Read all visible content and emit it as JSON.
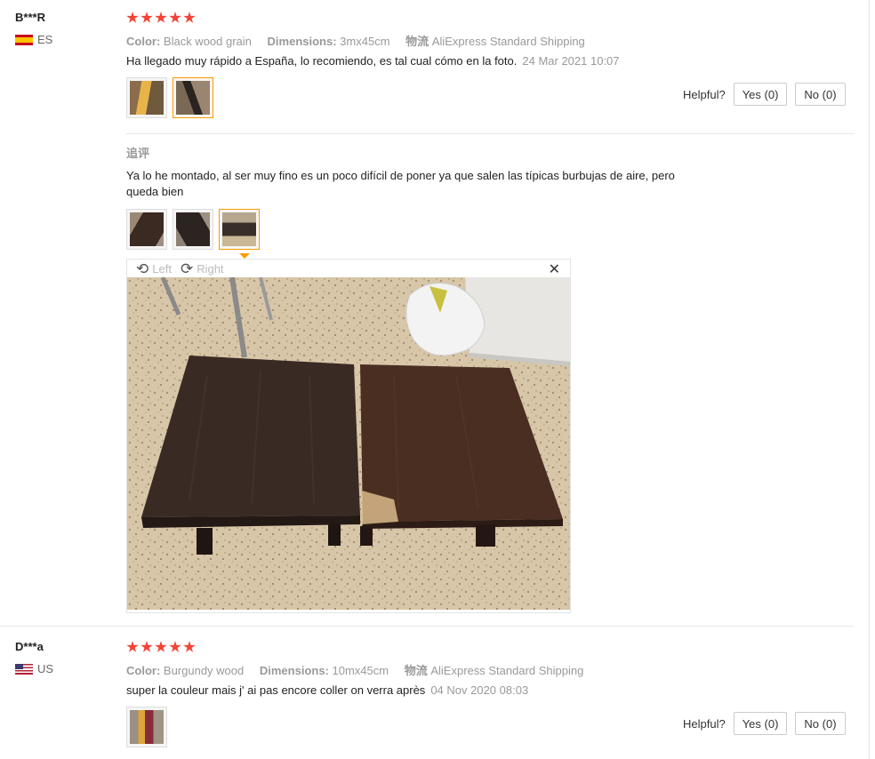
{
  "reviews": [
    {
      "username": "B***R",
      "country": "ES",
      "rating": 5,
      "attrs": {
        "color_label": "Color:",
        "color_value": "Black wood grain",
        "dim_label": "Dimensions:",
        "dim_value": "3mx45cm",
        "ship_label": "物流",
        "ship_value": "AliExpress Standard Shipping"
      },
      "text": "Ha llegado muy rápido a España, lo recomiendo, es tal cual cómo en la foto.",
      "date": "24 Mar 2021 10:07",
      "helpful_label": "Helpful?",
      "yes_label": "Yes (0)",
      "no_label": "No (0)",
      "append": {
        "label": "追评",
        "text_line1": "Ya lo he montado, al ser muy fino es un poco difícil de poner ya que salen las típicas burbujas de aire, pero",
        "text_line2": "queda bien"
      }
    },
    {
      "username": "D***a",
      "country": "US",
      "rating": 5,
      "attrs": {
        "color_label": "Color:",
        "color_value": "Burgundy wood",
        "dim_label": "Dimensions:",
        "dim_value": "10mx45cm",
        "ship_label": "物流",
        "ship_value": "AliExpress Standard Shipping"
      },
      "text": "super la couleur mais j' ai pas encore coller on verra après",
      "date": "04 Nov 2020 08:03",
      "helpful_label": "Helpful?",
      "yes_label": "Yes (0)",
      "no_label": "No (0)"
    }
  ],
  "viewer": {
    "left_label": "Left",
    "right_label": "Right",
    "close_icon": "close-icon"
  },
  "colors": {
    "star": "#f44336",
    "active_thumb": "#ff9900"
  }
}
